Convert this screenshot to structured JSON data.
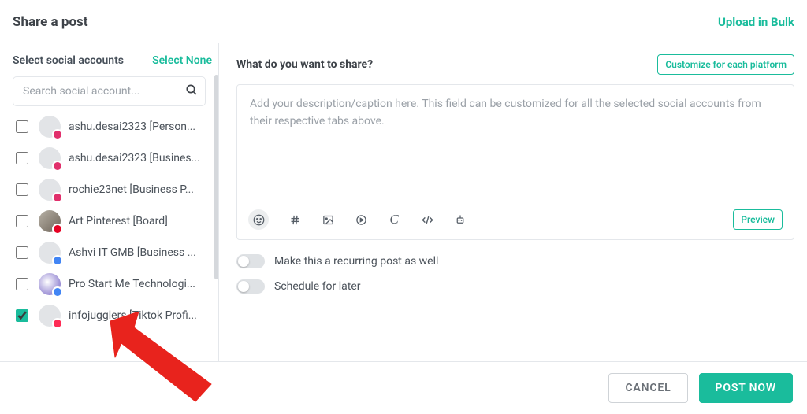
{
  "header": {
    "title": "Share a post",
    "bulk_link": "Upload in Bulk"
  },
  "sidebar": {
    "title": "Select social accounts",
    "select_none": "Select None",
    "search_placeholder": "Search social account...",
    "accounts": [
      {
        "label": "ashu.desai2323 [Person...",
        "network": "ig",
        "checked": false,
        "avatar": "plain"
      },
      {
        "label": "ashu.desai2323 [Busines...",
        "network": "ig",
        "checked": false,
        "avatar": "plain"
      },
      {
        "label": "rochie23net [Business P...",
        "network": "ig",
        "checked": false,
        "avatar": "plain"
      },
      {
        "label": "Art Pinterest [Board]",
        "network": "pn",
        "checked": false,
        "avatar": "img1"
      },
      {
        "label": "Ashvi IT GMB [Business ...",
        "network": "gb",
        "checked": false,
        "avatar": "plain"
      },
      {
        "label": "Pro Start Me Technologi...",
        "network": "gb",
        "checked": false,
        "avatar": "img2"
      },
      {
        "label": "infojugglers [Tiktok Profi...",
        "network": "tk",
        "checked": true,
        "avatar": "plain"
      }
    ]
  },
  "composer": {
    "title": "What do you want to share?",
    "customize_btn": "Customize for each platform",
    "placeholder": "Add your description/caption here. This field can be customized for all the selected social accounts from their respective tabs above.",
    "preview_btn": "Preview",
    "toolbar_icons": [
      "emoji",
      "hashtag",
      "image",
      "video",
      "canva",
      "embed",
      "ai"
    ],
    "toggle_recurring": "Make this a recurring post as well",
    "toggle_schedule": "Schedule for later"
  },
  "footer": {
    "cancel": "CANCEL",
    "post": "POST NOW"
  }
}
